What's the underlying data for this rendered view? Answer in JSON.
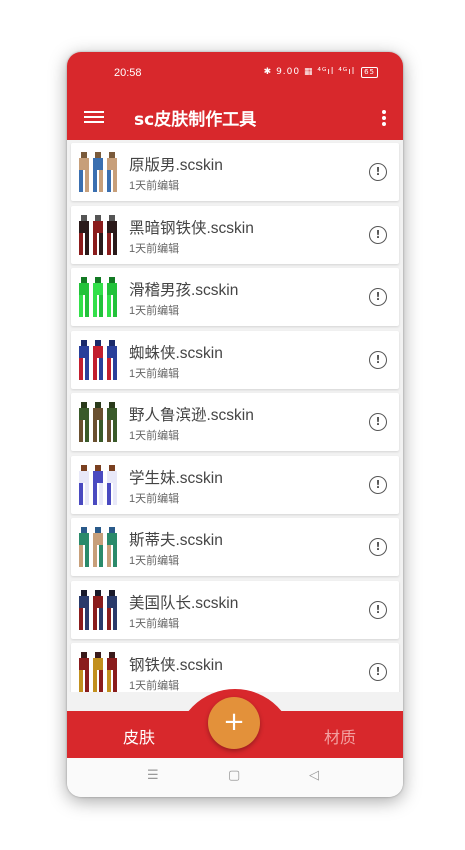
{
  "status_bar": {
    "time": "20:58",
    "icons_text": "✱ 9.00 ▦ ⁴ᴳıl ⁴ᴳıl",
    "battery": "65"
  },
  "app_bar": {
    "title": "sc皮肤制作工具",
    "menu_icon": "hamburger-icon",
    "more_icon": "more-vert-icon"
  },
  "skins": [
    {
      "name": "原版男.scskin",
      "edited": "1天前编辑",
      "colors": [
        "#c79f7a",
        "#3a6fb0",
        "#7a5a3a"
      ]
    },
    {
      "name": "黑暗钢铁侠.scskin",
      "edited": "1天前编辑",
      "colors": [
        "#2a1a1a",
        "#8b1c1c",
        "#555555"
      ]
    },
    {
      "name": "滑稽男孩.scskin",
      "edited": "1天前编辑",
      "colors": [
        "#22c23a",
        "#33e04a",
        "#137a24"
      ]
    },
    {
      "name": "蜘蛛侠.scskin",
      "edited": "1天前编辑",
      "colors": [
        "#2a3f9a",
        "#c21e2e",
        "#1b2a6a"
      ]
    },
    {
      "name": "野人鲁滨逊.scskin",
      "edited": "1天前编辑",
      "colors": [
        "#3a5a2a",
        "#6a5030",
        "#2a3a1a"
      ]
    },
    {
      "name": "学生妹.scskin",
      "edited": "1天前编辑",
      "colors": [
        "#e8e8f8",
        "#4a4ac0",
        "#7a4020"
      ]
    },
    {
      "name": "斯蒂夫.scskin",
      "edited": "1天前编辑",
      "colors": [
        "#2a8a6a",
        "#c79f7a",
        "#2a5a8a"
      ]
    },
    {
      "name": "美国队长.scskin",
      "edited": "1天前编辑",
      "colors": [
        "#2a3a6a",
        "#8a1c1c",
        "#1a1a2a"
      ]
    },
    {
      "name": "钢铁侠.scskin",
      "edited": "1天前编辑",
      "colors": [
        "#8a1c1c",
        "#c2901e",
        "#3a1a1a"
      ]
    }
  ],
  "info_icon": "info-icon",
  "fab": {
    "label": "+"
  },
  "bottom_nav": {
    "tab_skin": "皮肤",
    "tab_material": "材质"
  },
  "system_nav": {
    "menu": "☰",
    "home": "▢",
    "back": "◁"
  },
  "colors": {
    "primary": "#d8282c",
    "accent": "#e3913a"
  }
}
